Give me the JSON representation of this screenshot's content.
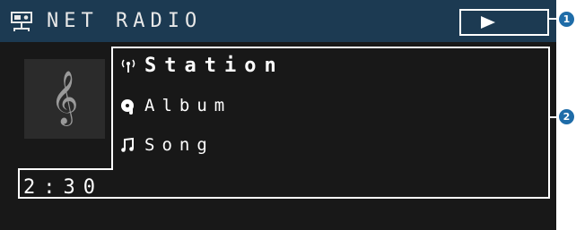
{
  "header": {
    "title": "NET RADIO",
    "play_button": "▶",
    "app_icon": "net-radio-icon"
  },
  "artwork": {
    "icon": "treble-clef-icon"
  },
  "info": {
    "station": "Station",
    "album": "Album",
    "song": "Song"
  },
  "playback": {
    "elapsed": "2:30"
  },
  "callouts": [
    "1",
    "2"
  ],
  "colors": {
    "screen_bg": "#181818",
    "header_bg": "#1c3a52",
    "art_bg": "#2b2b2b",
    "callout": "#1e6ca8",
    "text": "#ffffff"
  }
}
